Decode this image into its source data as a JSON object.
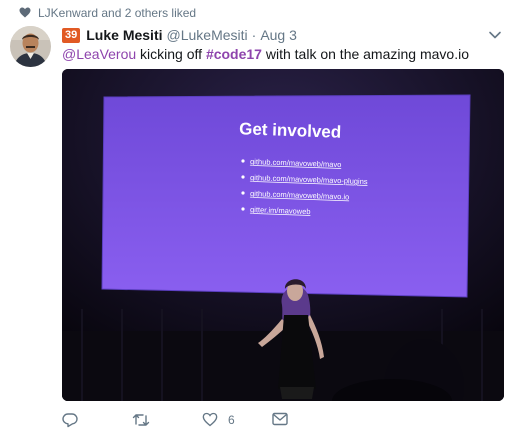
{
  "social_context": {
    "text": "LJKenward and 2 others liked",
    "icon": "heart-icon"
  },
  "tweet": {
    "badge": "39",
    "author_name": "Luke Mesiti",
    "handle": "@LukeMesiti",
    "separator": "·",
    "time": "Aug 3",
    "text": {
      "mention": "@LeaVerou",
      "part1": " kicking off ",
      "hashtag": "#code17",
      "part2": " with talk on the amazing mavo.io"
    },
    "media": {
      "slide_title": "Get involved",
      "slide_links": [
        "github.com/mavoweb/mavo",
        "github.com/mavoweb/mavo-plugins",
        "github.com/mavoweb/mavo.io",
        "gitter.im/mavoweb"
      ]
    },
    "actions": {
      "reply_icon": "reply-icon",
      "retweet_icon": "retweet-icon",
      "like_icon": "heart-outline-icon",
      "like_count": "6",
      "message_icon": "envelope-icon"
    },
    "colors": {
      "link": "#8e44ad",
      "badge": "#e15a24",
      "slide": "#7c55e6"
    }
  }
}
